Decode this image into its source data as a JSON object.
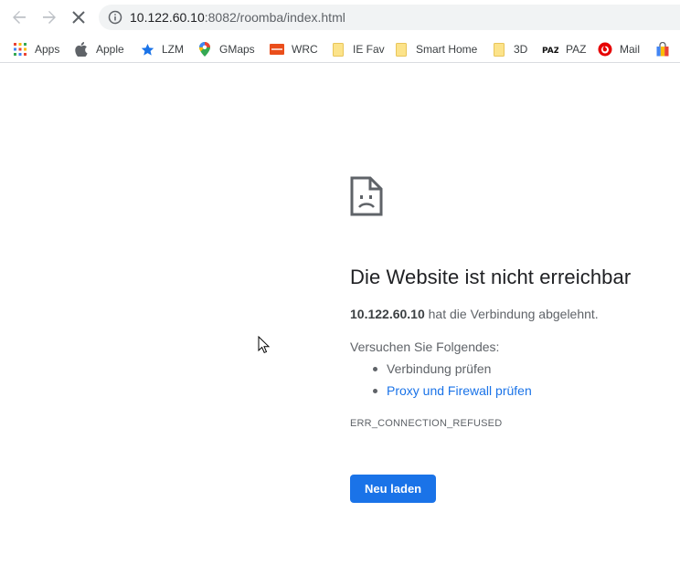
{
  "toolbar": {
    "back_icon": "arrow-left-icon",
    "forward_icon": "arrow-right-icon",
    "stop_icon": "close-icon",
    "url_host": "10.122.60.10",
    "url_rest": ":8082/roomba/index.html"
  },
  "bookmarks": [
    {
      "label": "Apps",
      "icon": "apps-grid-icon"
    },
    {
      "label": "Apple",
      "icon": "apple-icon"
    },
    {
      "label": "LZM",
      "icon": "star-icon"
    },
    {
      "label": "GMaps",
      "icon": "map-pin-icon"
    },
    {
      "label": "WRC",
      "icon": "wrc-logo-icon"
    },
    {
      "label": "IE Fav",
      "icon": "folder-icon"
    },
    {
      "label": "Smart Home",
      "icon": "folder-icon"
    },
    {
      "label": "3D",
      "icon": "folder-icon"
    },
    {
      "label": "PAZ",
      "icon": "paz-logo-icon"
    },
    {
      "label": "Mail",
      "icon": "vodafone-icon"
    },
    {
      "label": "",
      "icon": "shopping-bag-icon"
    }
  ],
  "error": {
    "title": "Die Website ist nicht erreichbar",
    "host": "10.122.60.10",
    "message": " hat die Verbindung abgelehnt.",
    "try_heading": "Versuchen Sie Folgendes:",
    "suggestions": [
      "Verbindung prüfen",
      "Proxy und Firewall prüfen"
    ],
    "code": "ERR_CONNECTION_REFUSED",
    "reload_label": "Neu laden"
  },
  "colors": {
    "accent": "#1a73e8",
    "text": "#202124",
    "muted": "#5f6368"
  }
}
